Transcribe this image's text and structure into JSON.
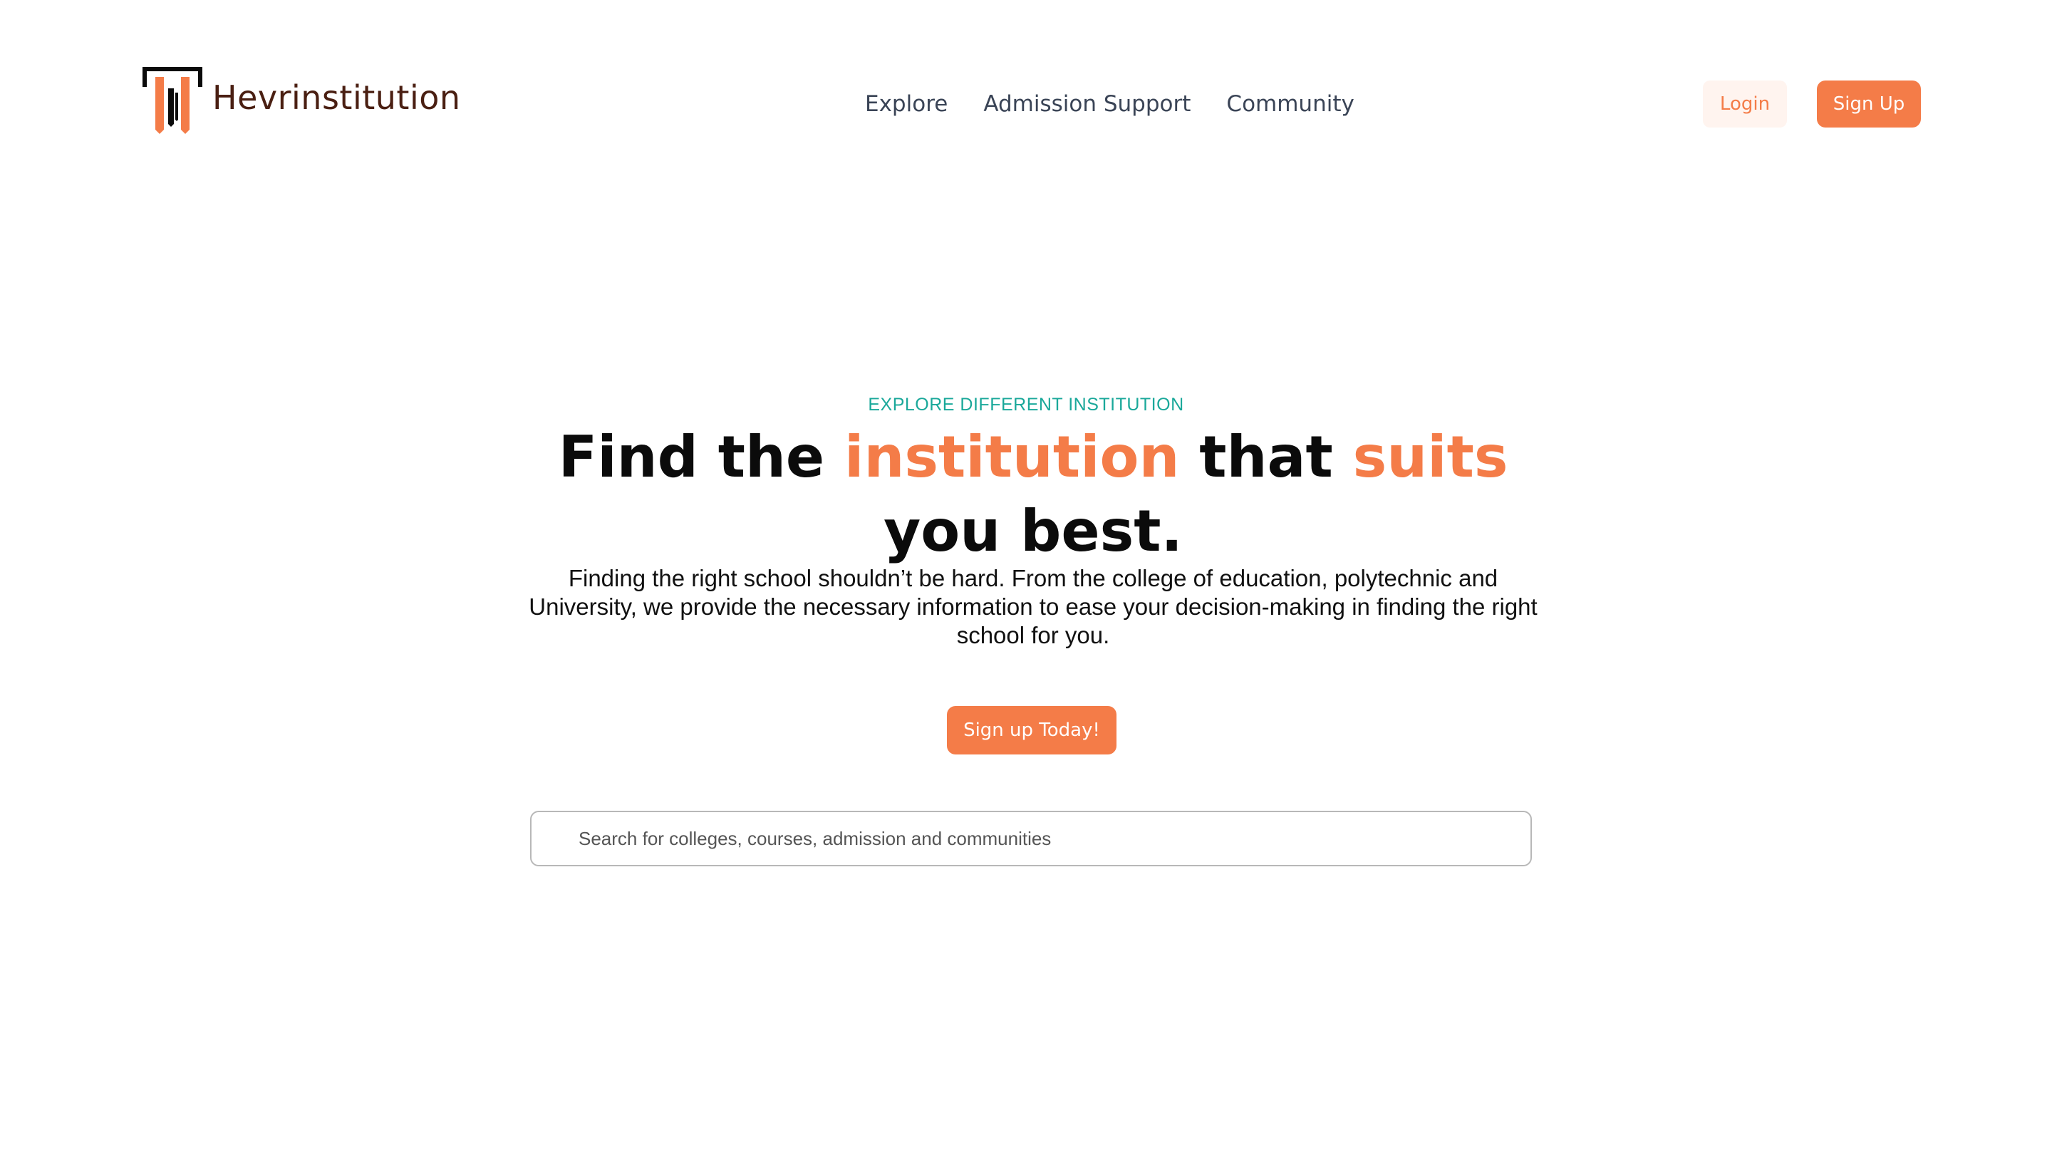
{
  "header": {
    "brand": "Hevrinstitution",
    "nav": [
      {
        "label": "Explore"
      },
      {
        "label": "Admission Support"
      },
      {
        "label": "Community"
      }
    ],
    "login_label": "Login",
    "signup_label": "Sign Up"
  },
  "hero": {
    "eyebrow": "EXPLORE DIFFERENT INSTITUTION",
    "headline": {
      "part1": "Find the ",
      "accent1": "institution",
      "part2": " that ",
      "accent2": "suits",
      "part3": " you best."
    },
    "description": "Finding the right school shouldn’t be hard. From the college of education, polytechnic and University, we provide the necessary information to ease your decision-making in finding the right school for you.",
    "cta_label": "Sign up Today!"
  },
  "search": {
    "placeholder": "Search for colleges, courses, admission and communities",
    "value": ""
  },
  "colors": {
    "accent": "#f47c48",
    "teal": "#1aa89a",
    "brand_text": "#4a1f12",
    "nav_text": "#3a4456"
  },
  "icons": {
    "logo": "pillar-logo-icon"
  }
}
